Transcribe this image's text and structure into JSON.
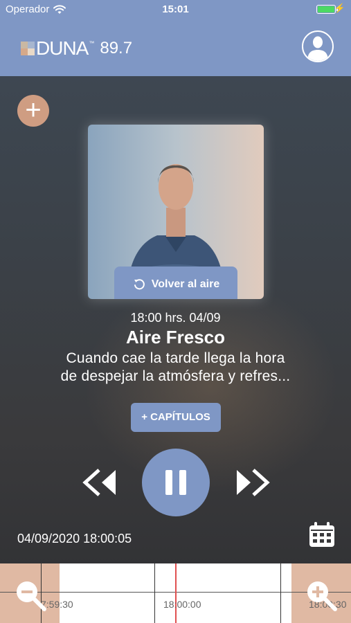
{
  "status_bar": {
    "carrier": "Operador",
    "time": "15:01",
    "battery_level": 1.0
  },
  "header": {
    "logo_name": "DUNA",
    "logo_tm": "™",
    "frequency": "89.7"
  },
  "player": {
    "back_live_label": "Volver al aire",
    "show_datetime": "18:00 hrs. 04/09",
    "show_title": "Aire Fresco",
    "show_description_line1": "Cuando cae la tarde llega la hora",
    "show_description_line2": "de despejar la atmósfera y refres...",
    "chapters_label": "+ CAPÍTULOS",
    "current_timestamp": "04/09/2020 18:00:05"
  },
  "timeline": {
    "labels": [
      "7:59:30",
      "18:00:00",
      "18:00:30"
    ]
  },
  "colors": {
    "accent": "#7f97c5",
    "add": "#cf9d82",
    "timeline_zone": "#e0b9a3",
    "now_marker": "#e05050",
    "battery": "#4cd964"
  },
  "icons": [
    "wifi-icon",
    "battery-icon",
    "profile-icon",
    "plus-icon",
    "replay-icon",
    "rewind-icon",
    "pause-icon",
    "fast-forward-icon",
    "calendar-icon",
    "zoom-out-icon",
    "zoom-in-icon"
  ]
}
